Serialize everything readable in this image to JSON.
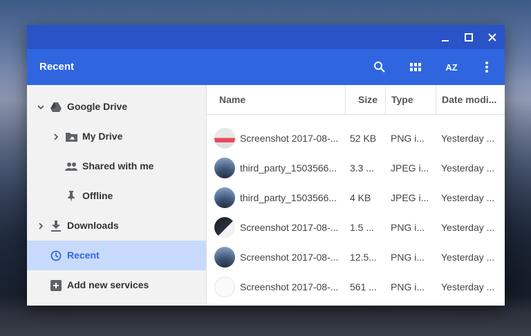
{
  "window": {
    "controls": [
      "minimize-icon",
      "maximize-icon",
      "close-icon"
    ]
  },
  "appbar": {
    "title": "Recent",
    "icons": [
      "search-icon",
      "grid-view-icon",
      "sort-az-icon",
      "more-vert-icon"
    ],
    "sort_label": "AZ"
  },
  "sidebar": {
    "items": [
      {
        "label": "Google Drive",
        "icon": "google-drive-icon",
        "expanded": true
      },
      {
        "label": "My Drive",
        "icon": "folder-drive-icon"
      },
      {
        "label": "Shared with me",
        "icon": "people-icon"
      },
      {
        "label": "Offline",
        "icon": "pin-icon"
      },
      {
        "label": "Downloads",
        "icon": "download-icon"
      },
      {
        "label": "Recent",
        "icon": "clock-icon",
        "active": true
      },
      {
        "label": "Add new services",
        "icon": "add-box-icon"
      }
    ]
  },
  "table": {
    "columns": [
      "Name",
      "Size",
      "Type",
      "Date modi..."
    ],
    "rows": [
      {
        "name": "Screenshot 2017-08-...",
        "size": "52 KB",
        "type": "PNG i...",
        "date": "Yesterday ..."
      },
      {
        "name": "third_party_1503566...",
        "size": "3.3 ...",
        "type": "JPEG i...",
        "date": "Yesterday ..."
      },
      {
        "name": "third_party_1503566...",
        "size": "4 KB",
        "type": "JPEG i...",
        "date": "Yesterday ..."
      },
      {
        "name": "Screenshot 2017-08-...",
        "size": "1.5 ...",
        "type": "PNG i...",
        "date": "Yesterday ..."
      },
      {
        "name": "Screenshot 2017-08-...",
        "size": "12.5...",
        "type": "PNG i...",
        "date": "Yesterday ..."
      },
      {
        "name": "Screenshot 2017-08-...",
        "size": "561 ...",
        "type": "PNG i...",
        "date": "Yesterday ..."
      }
    ]
  },
  "colors": {
    "titlebar": "#2953c7",
    "appbar": "#2f66e0",
    "active_nav_bg": "#c8dafc"
  }
}
